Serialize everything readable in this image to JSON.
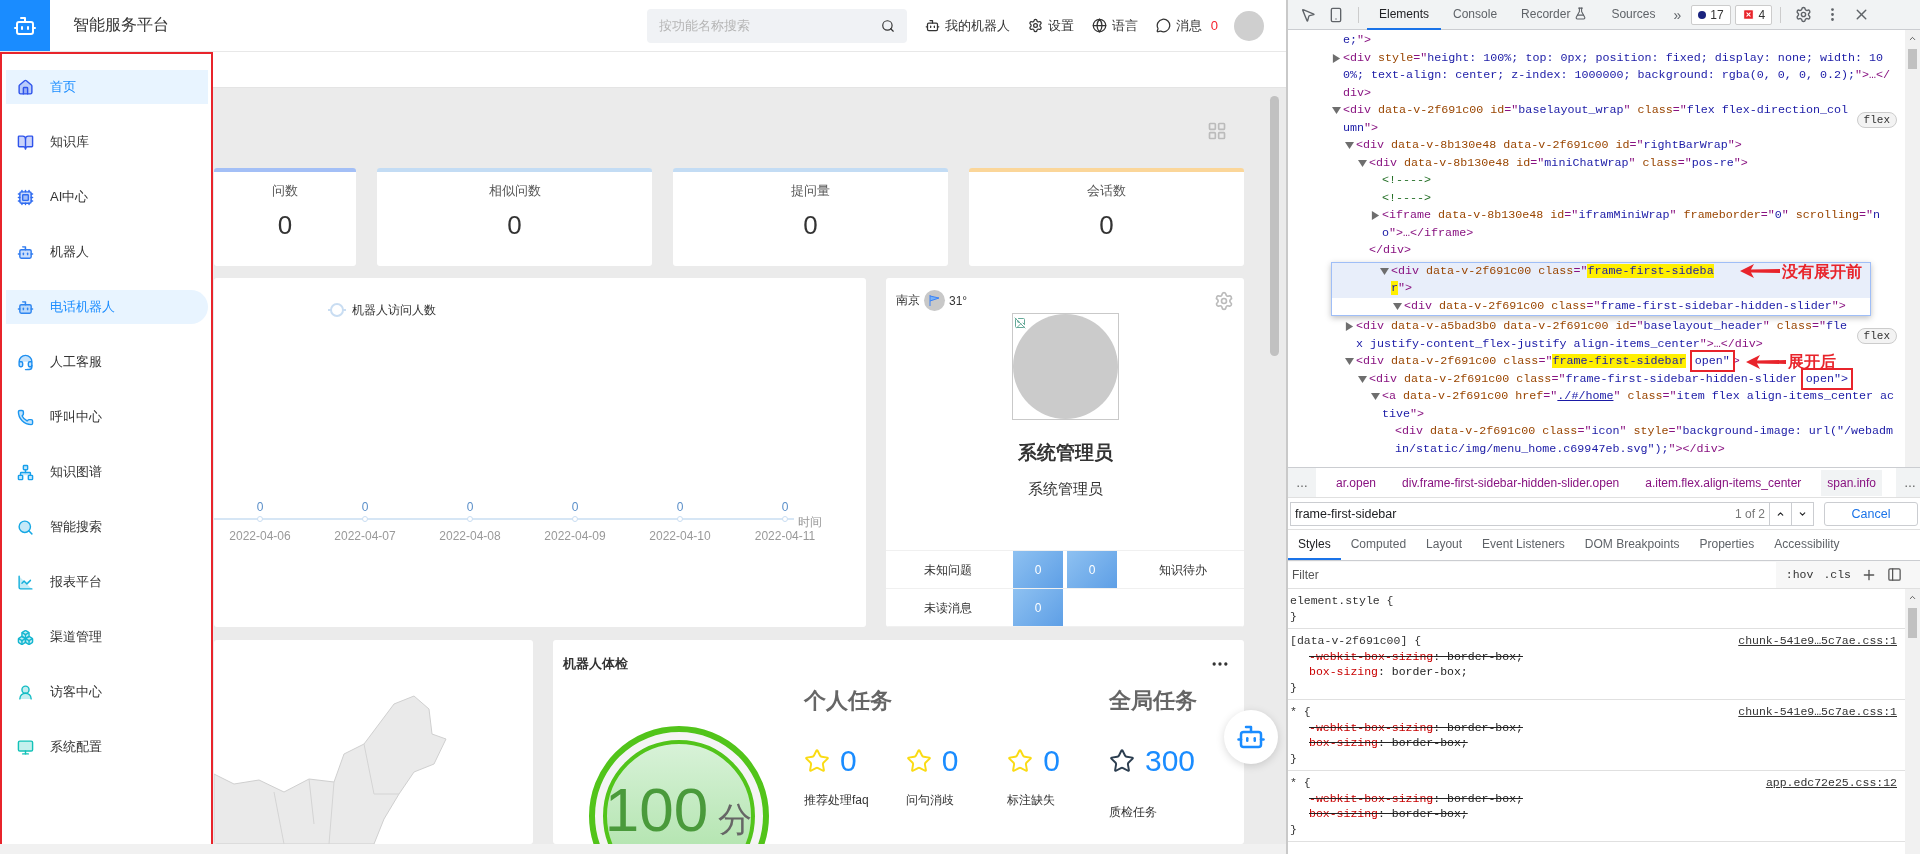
{
  "header": {
    "title": "智能服务平台",
    "search": {
      "placeholder": "按功能名称搜索"
    },
    "nav": [
      {
        "label": "我的机器人"
      },
      {
        "label": "设置"
      },
      {
        "label": "语言"
      },
      {
        "label": "消息",
        "count": "0"
      }
    ]
  },
  "sidebar": {
    "items": [
      {
        "label": "首页",
        "selected": true,
        "hovered": false
      },
      {
        "label": "知识库",
        "selected": false,
        "hovered": false
      },
      {
        "label": "AI中心",
        "selected": false,
        "hovered": false
      },
      {
        "label": "机器人",
        "selected": false,
        "hovered": false
      },
      {
        "label": "电话机器人",
        "selected": false,
        "hovered": true
      },
      {
        "label": "人工客服",
        "selected": false,
        "hovered": false
      },
      {
        "label": "呼叫中心",
        "selected": false,
        "hovered": false
      },
      {
        "label": "知识图谱",
        "selected": false,
        "hovered": false
      },
      {
        "label": "智能搜索",
        "selected": false,
        "hovered": false
      },
      {
        "label": "报表平台",
        "selected": false,
        "hovered": false
      },
      {
        "label": "渠道管理",
        "selected": false,
        "hovered": false
      },
      {
        "label": "访客中心",
        "selected": false,
        "hovered": false
      },
      {
        "label": "系统配置",
        "selected": false,
        "hovered": false
      }
    ]
  },
  "stat_cards": [
    {
      "label": "问数",
      "value": "0",
      "color": "#a3bff6"
    },
    {
      "label": "相似问数",
      "value": "0",
      "color": "#c3dcf4"
    },
    {
      "label": "提问量",
      "value": "0",
      "color": "#c3dcf4"
    },
    {
      "label": "会话数",
      "value": "0",
      "color": "#fbd699"
    }
  ],
  "visits_chart": {
    "legend": "机器人访问人数",
    "x_labels": [
      "2022-04-06",
      "2022-04-07",
      "2022-04-08",
      "2022-04-09",
      "2022-04-10",
      "2022-04-11"
    ],
    "point_labels": [
      "0",
      "0",
      "0",
      "0",
      "0",
      "0"
    ],
    "axis_title": "时间"
  },
  "profile": {
    "city": "南京",
    "temperature": "31°",
    "name": "系统管理员",
    "role": "系统管理员",
    "stat_rows": [
      {
        "cells": [
          {
            "kind": "label",
            "text": "未知问题"
          },
          {
            "kind": "tile",
            "text": "0"
          },
          {
            "kind": "tile",
            "text": "0"
          },
          {
            "kind": "label",
            "text": "知识待办"
          }
        ]
      },
      {
        "cells": [
          {
            "kind": "label",
            "text": "未读消息"
          },
          {
            "kind": "tile",
            "text": "0"
          }
        ]
      }
    ]
  },
  "health_check": {
    "title": "机器人体检",
    "score": "100",
    "unit": "分",
    "groups": [
      {
        "kind": "personal",
        "title": "个人任务",
        "tasks": [
          {
            "count": "0",
            "label": "推荐处理faq"
          },
          {
            "count": "0",
            "label": "问句消歧"
          },
          {
            "count": "0",
            "label": "标注缺失"
          }
        ]
      },
      {
        "kind": "global",
        "title": "全局任务",
        "tasks": [
          {
            "count": "300",
            "label": "质检任务"
          }
        ]
      }
    ]
  },
  "devtools": {
    "tabs": [
      {
        "label": "Elements",
        "selected": true
      },
      {
        "label": "Console",
        "selected": false
      },
      {
        "label": "Recorder",
        "selected": false
      },
      {
        "label": "Sources",
        "selected": false
      }
    ],
    "more_tabs": "»",
    "warnings": "17",
    "errors": "4",
    "dom_tree": [
      {
        "kind": "line",
        "parts": [
          {
            "kind": "value",
            "t": "e;"
          },
          {
            "kind": "tag",
            "t": "\">"
          }
        ]
      },
      {
        "kind": "line",
        "expanded": false,
        "parts": [
          {
            "kind": "tag",
            "t": "<div "
          },
          {
            "kind": "attr",
            "t": "style"
          },
          {
            "kind": "tag",
            "t": "=\""
          },
          {
            "kind": "value",
            "t": "height: 100%; top: 0px; position: fixed; display: none; width: 100%; text-align: center; z-index: 1000000; background: rgba(0, 0, 0, 0.2);"
          },
          {
            "kind": "tag",
            "t": "\">…</div>"
          }
        ]
      },
      {
        "kind": "line",
        "expanded": true,
        "badge": "flex",
        "parts": [
          {
            "kind": "tag",
            "t": "<div "
          },
          {
            "kind": "attr",
            "t": "data-v-2f691c00 id"
          },
          {
            "kind": "tag",
            "t": "=\""
          },
          {
            "kind": "value",
            "t": "baselayout_wrap"
          },
          {
            "kind": "tag",
            "t": "\" "
          },
          {
            "kind": "attr",
            "t": "class"
          },
          {
            "kind": "tag",
            "t": "=\""
          },
          {
            "kind": "value",
            "t": "flex flex-direction_column"
          },
          {
            "kind": "tag",
            "t": "\">"
          }
        ],
        "children": [
          {
            "kind": "line",
            "expanded": true,
            "parts": [
              {
                "kind": "tag",
                "t": "<div "
              },
              {
                "kind": "attr",
                "t": "data-v-8b130e48 data-v-2f691c00 id"
              },
              {
                "kind": "tag",
                "t": "=\""
              },
              {
                "kind": "value",
                "t": "rightBarWrap"
              },
              {
                "kind": "tag",
                "t": "\">"
              }
            ],
            "children": [
              {
                "kind": "line",
                "expanded": true,
                "parts": [
                  {
                    "kind": "tag",
                    "t": "<div "
                  },
                  {
                    "kind": "attr",
                    "t": "data-v-8b130e48 id"
                  },
                  {
                    "kind": "tag",
                    "t": "=\""
                  },
                  {
                    "kind": "value",
                    "t": "miniChatWrap"
                  },
                  {
                    "kind": "tag",
                    "t": "\" "
                  },
                  {
                    "kind": "attr",
                    "t": "class"
                  },
                  {
                    "kind": "tag",
                    "t": "=\""
                  },
                  {
                    "kind": "value",
                    "t": "pos-re"
                  },
                  {
                    "kind": "tag",
                    "t": "\">"
                  }
                ],
                "children": [
                  {
                    "kind": "line",
                    "parts": [
                      {
                        "kind": "comment",
                        "t": "<!---->"
                      }
                    ]
                  },
                  {
                    "kind": "line",
                    "parts": [
                      {
                        "kind": "comment",
                        "t": "<!---->"
                      }
                    ]
                  },
                  {
                    "kind": "line",
                    "expanded": false,
                    "parts": [
                      {
                        "kind": "tag",
                        "t": "<iframe "
                      },
                      {
                        "kind": "attr",
                        "t": "data-v-8b130e48 id"
                      },
                      {
                        "kind": "tag",
                        "t": "=\""
                      },
                      {
                        "kind": "value",
                        "t": "iframMiniWrap"
                      },
                      {
                        "kind": "tag",
                        "t": "\" "
                      },
                      {
                        "kind": "attr",
                        "t": "frameborder"
                      },
                      {
                        "kind": "tag",
                        "t": "=\""
                      },
                      {
                        "kind": "value",
                        "t": "0"
                      },
                      {
                        "kind": "tag",
                        "t": "\" "
                      },
                      {
                        "kind": "attr",
                        "t": "scrolling"
                      },
                      {
                        "kind": "tag",
                        "t": "=\""
                      },
                      {
                        "kind": "value",
                        "t": "no"
                      },
                      {
                        "kind": "tag",
                        "t": "\">…</iframe>"
                      }
                    ]
                  }
                ]
              },
              {
                "kind": "line",
                "parts": [
                  {
                    "kind": "tag",
                    "t": "</div>"
                  }
                ]
              }
            ]
          },
          {
            "kind": "popup",
            "note": "没有展开前",
            "lines": [
              {
                "kind": "line",
                "expanded": true,
                "parts": [
                  {
                    "kind": "tag",
                    "t": "<div "
                  },
                  {
                    "kind": "attr",
                    "t": "data-v-2f691c00 class"
                  },
                  {
                    "kind": "tag",
                    "t": "=\""
                  },
                  {
                    "kind": "match",
                    "t": "frame-first-sidebar"
                  },
                  {
                    "kind": "tag",
                    "t": "\">"
                  }
                ],
                "children": [
                  {
                    "kind": "line",
                    "expanded": true,
                    "parts": [
                      {
                        "kind": "tag",
                        "t": "<div "
                      },
                      {
                        "kind": "attr",
                        "t": "data-v-2f691c00 class"
                      },
                      {
                        "kind": "tag",
                        "t": "=\""
                      },
                      {
                        "kind": "value",
                        "t": "frame-first-sidebar-hidden-slider"
                      },
                      {
                        "kind": "tag",
                        "t": "\">"
                      }
                    ]
                  }
                ]
              }
            ]
          },
          {
            "kind": "line",
            "expanded": false,
            "badge": "flex",
            "parts": [
              {
                "kind": "tag",
                "t": "<div "
              },
              {
                "kind": "attr",
                "t": "data-v-a5bad3b0 data-v-2f691c00 id"
              },
              {
                "kind": "tag",
                "t": "=\""
              },
              {
                "kind": "value",
                "t": "baselayout_header"
              },
              {
                "kind": "tag",
                "t": "\" "
              },
              {
                "kind": "attr",
                "t": "class"
              },
              {
                "kind": "tag",
                "t": "=\""
              },
              {
                "kind": "value",
                "t": "flex justify-content_flex-justify align-items_center"
              },
              {
                "kind": "tag",
                "t": "\">…</div>"
              }
            ]
          },
          {
            "kind": "line",
            "expanded": true,
            "note": "展开后",
            "parts": [
              {
                "kind": "tag",
                "t": "<div "
              },
              {
                "kind": "attr",
                "t": "data-v-2f691c00 class"
              },
              {
                "kind": "tag",
                "t": "=\""
              },
              {
                "kind": "match",
                "t": "frame-first-sidebar"
              },
              {
                "kind": "boxed",
                "t": "open\""
              },
              {
                "kind": "tag",
                "t": ">"
              }
            ],
            "children": [
              {
                "kind": "line",
                "expanded": true,
                "parts": [
                  {
                    "kind": "tag",
                    "t": "<div "
                  },
                  {
                    "kind": "attr",
                    "t": "data-v-2f691c00 class"
                  },
                  {
                    "kind": "tag",
                    "t": "=\""
                  },
                  {
                    "kind": "value",
                    "t": "frame-first-sidebar-hidden-slider"
                  },
                  {
                    "kind": "boxed",
                    "t": "open\">"
                  }
                ],
                "children": [
                  {
                    "kind": "line",
                    "expanded": true,
                    "parts": [
                      {
                        "kind": "tag",
                        "t": "<a "
                      },
                      {
                        "kind": "attr",
                        "t": "data-v-2f691c00 href"
                      },
                      {
                        "kind": "tag",
                        "t": "=\""
                      },
                      {
                        "kind": "link",
                        "t": "./#/home"
                      },
                      {
                        "kind": "tag",
                        "t": "\" "
                      },
                      {
                        "kind": "attr",
                        "t": "class"
                      },
                      {
                        "kind": "tag",
                        "t": "=\""
                      },
                      {
                        "kind": "value",
                        "t": "item flex align-items_center active"
                      },
                      {
                        "kind": "tag",
                        "t": "\">"
                      }
                    ],
                    "children": [
                      {
                        "kind": "line",
                        "parts": [
                          {
                            "kind": "tag",
                            "t": "<div "
                          },
                          {
                            "kind": "attr",
                            "t": "data-v-2f691c00 class"
                          },
                          {
                            "kind": "tag",
                            "t": "=\""
                          },
                          {
                            "kind": "value",
                            "t": "icon"
                          },
                          {
                            "kind": "tag",
                            "t": "\" "
                          },
                          {
                            "kind": "attr",
                            "t": "style"
                          },
                          {
                            "kind": "tag",
                            "t": "=\""
                          },
                          {
                            "kind": "value",
                            "t": "background-image: url(\"/webadmin/static/img/menu_home.c69947eb.svg\");"
                          },
                          {
                            "kind": "tag",
                            "t": "\"></div>"
                          }
                        ]
                      }
                    ]
                  }
                ]
              }
            ]
          }
        ]
      }
    ],
    "breadcrumb": {
      "more": "…",
      "items": [
        {
          "label": "ar.open",
          "selected": false
        },
        {
          "label": "div.frame-first-sidebar-hidden-slider.open",
          "selected": false
        },
        {
          "label": "a.item.flex.align-items_center",
          "selected": false
        },
        {
          "label": "span.info",
          "selected": true
        }
      ],
      "more_end": "…"
    },
    "search": {
      "value": "frame-first-sidebar",
      "count": "1 of 2",
      "cancel": "Cancel"
    },
    "pane_tabs": [
      {
        "label": "Styles",
        "selected": true
      },
      {
        "label": "Computed",
        "selected": false
      },
      {
        "label": "Layout",
        "selected": false
      },
      {
        "label": "Event Listeners",
        "selected": false
      },
      {
        "label": "DOM Breakpoints",
        "selected": false
      },
      {
        "label": "Properties",
        "selected": false
      },
      {
        "label": "Accessibility",
        "selected": false
      }
    ],
    "filter": {
      "placeholder": "Filter",
      "hov": ":hov",
      "cls": ".cls"
    },
    "rules": [
      {
        "selector": "element.style {",
        "close": "}"
      },
      {
        "selector": "[data-v-2f691c00] {",
        "source": "chunk-541e9…5c7ae.css:1",
        "declarations": [
          {
            "prop": "-webkit-box-sizing",
            "value": ": border-box;",
            "struck": true
          },
          {
            "prop": "box-sizing",
            "value": ": border-box;",
            "struck": false
          }
        ],
        "close": "}"
      },
      {
        "selector": "* {",
        "source": "chunk-541e9…5c7ae.css:1",
        "declarations": [
          {
            "prop": "-webkit-box-sizing",
            "value": ": border-box;",
            "struck": true
          },
          {
            "prop": "box-sizing",
            "value": ": border-box;",
            "struck": true
          }
        ],
        "close": "}"
      },
      {
        "selector": "* {",
        "source": "app.edc72e25.css:12",
        "declarations": [
          {
            "prop": "-webkit-box-sizing",
            "value": ": border-box;",
            "struck": true
          },
          {
            "prop": "box-sizing",
            "value": ": border-box;",
            "struck": true
          }
        ],
        "close": "}"
      }
    ]
  }
}
